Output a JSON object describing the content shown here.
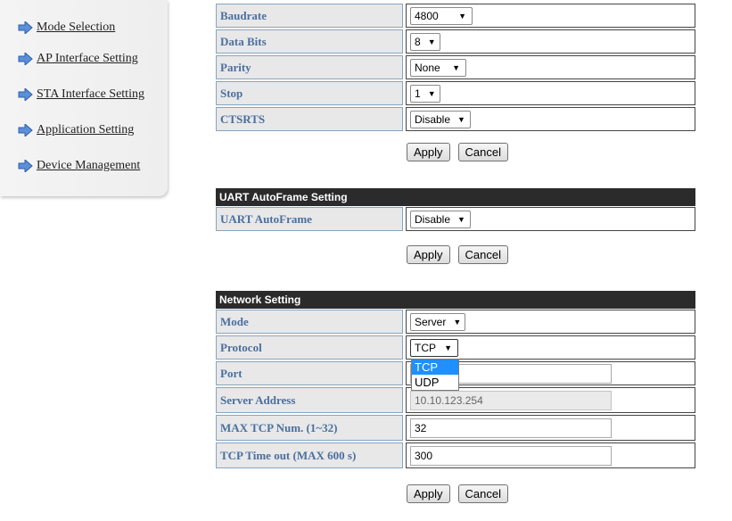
{
  "sidebar": {
    "items": [
      {
        "label": "Mode Selection"
      },
      {
        "label": "AP Interface Setting"
      },
      {
        "label": "STA Interface Setting"
      },
      {
        "label": "Application Setting"
      },
      {
        "label": "Device Management"
      }
    ]
  },
  "uart": {
    "rows": [
      {
        "label": "Baudrate",
        "value": "4800"
      },
      {
        "label": "Data Bits",
        "value": "8"
      },
      {
        "label": "Parity",
        "value": "None"
      },
      {
        "label": "Stop",
        "value": "1"
      },
      {
        "label": "CTSRTS",
        "value": "Disable"
      }
    ],
    "apply": "Apply",
    "cancel": "Cancel"
  },
  "autoframe": {
    "title": "UART AutoFrame Setting",
    "row": {
      "label": "UART AutoFrame",
      "value": "Disable"
    },
    "apply": "Apply",
    "cancel": "Cancel"
  },
  "network": {
    "title": "Network Setting",
    "mode": {
      "label": "Mode",
      "value": "Server"
    },
    "protocol": {
      "label": "Protocol",
      "value": "TCP",
      "options": [
        "TCP",
        "UDP"
      ]
    },
    "port": {
      "label": "Port",
      "value": ""
    },
    "server_address": {
      "label": "Server Address",
      "value": "10.10.123.254"
    },
    "max_tcp": {
      "label": "MAX TCP Num. (1~32)",
      "value": "32"
    },
    "tcp_timeout": {
      "label": "TCP Time out (MAX 600 s)",
      "value": "300"
    },
    "apply": "Apply",
    "cancel": "Cancel"
  },
  "icons": {
    "nav": "arrow-right-icon",
    "caret": "caret-down-icon"
  },
  "colors": {
    "label_text": "#4a6fa0",
    "header_bg": "#2b2b2b",
    "highlight": "#1e90ff"
  }
}
